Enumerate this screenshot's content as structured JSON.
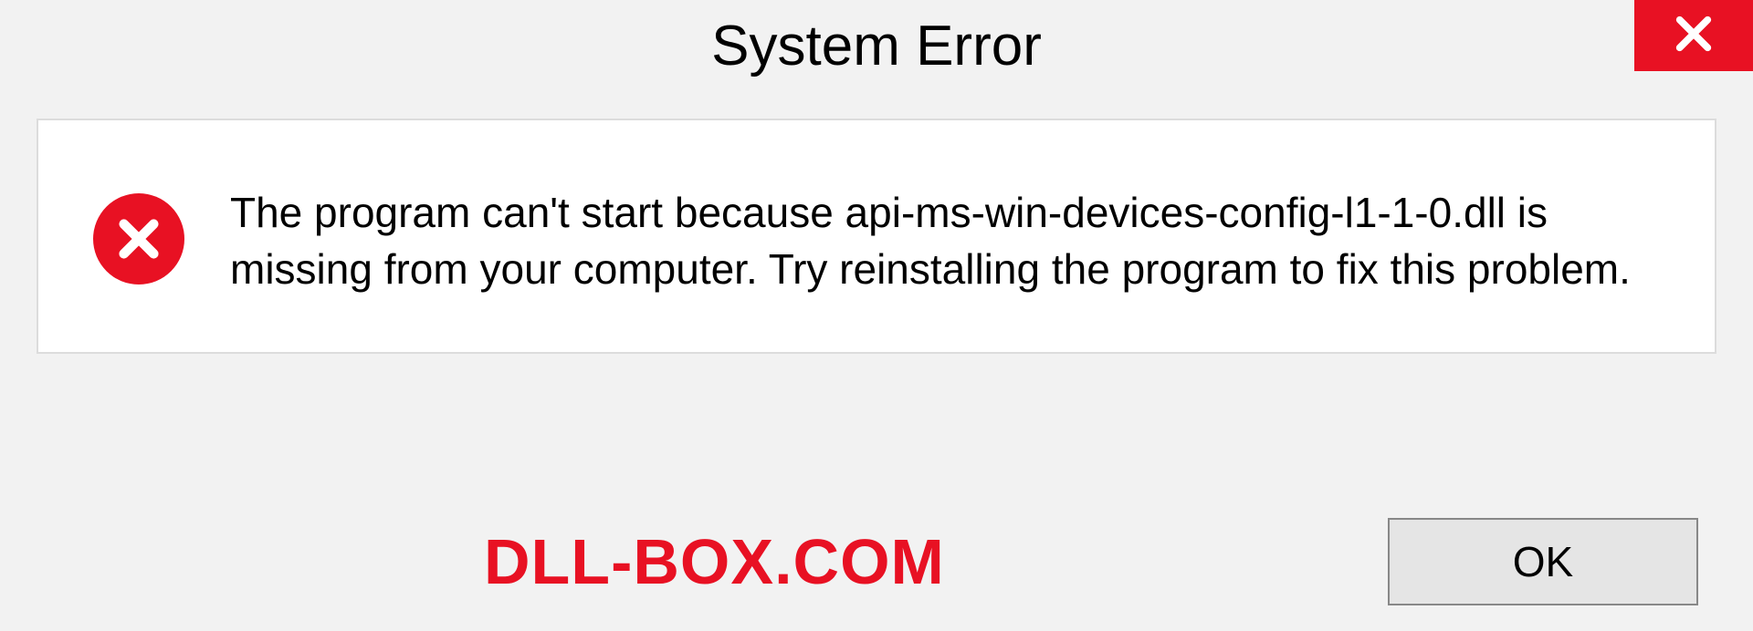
{
  "dialog": {
    "title": "System Error",
    "message": "The program can't start because api-ms-win-devices-config-l1-1-0.dll is missing from your computer. Try reinstalling the program to fix this problem.",
    "ok_label": "OK"
  },
  "watermark": "DLL-BOX.COM"
}
